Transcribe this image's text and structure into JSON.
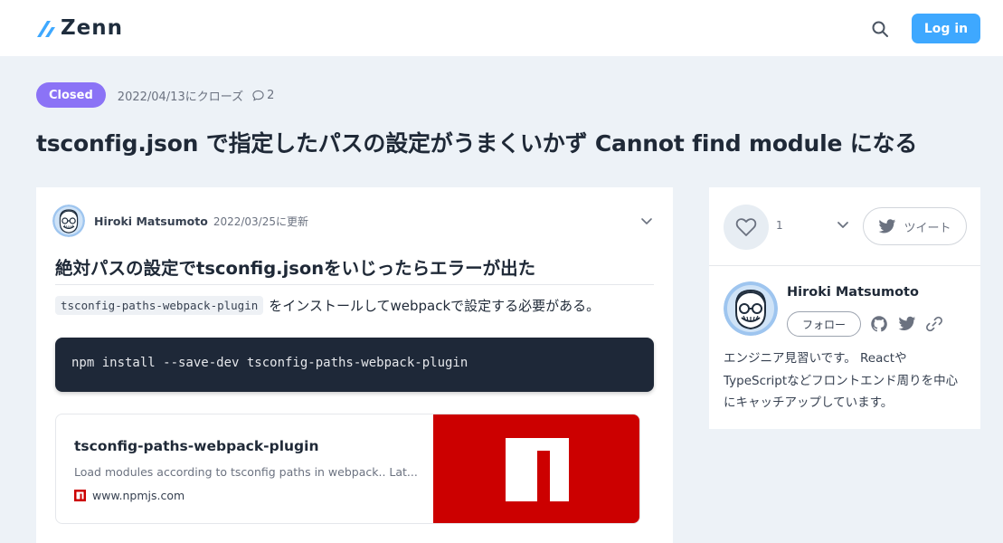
{
  "header": {
    "logo_text": "Zenn",
    "login_label": "Log in"
  },
  "discussion": {
    "status_label": "Closed",
    "closed_date": "2022/04/13にクローズ",
    "comment_count": "2",
    "title": "tsconfig.json で指定したパスの設定がうまくいかず Cannot find module になる"
  },
  "post": {
    "author_name": "Hiroki Matsumoto",
    "updated": "2022/03/25に更新",
    "heading": "絶対パスの設定でtsconfig.jsonをいじったらエラーが出た",
    "inline_code": "tsconfig-paths-webpack-plugin",
    "body_text": "をインストールしてwebpackで設定する必要がある。",
    "code": "npm install --save-dev tsconfig-paths-webpack-plugin",
    "link_card": {
      "title": "tsconfig-paths-webpack-plugin",
      "description": "Load modules according to tsconfig paths in webpack.. Lat...",
      "host": "www.npmjs.com"
    }
  },
  "sidebar": {
    "like_count": "1",
    "tweet_label": "ツイート",
    "author_name": "Hiroki Matsumoto",
    "follow_label": "フォロー",
    "bio": "エンジニア見習いです。 ReactやTypeScriptなどフロントエンド周りを中心にキャッチアップしています。"
  },
  "colors": {
    "accent": "#3ea8ff",
    "closed_badge": "#8b73f6",
    "npm_red": "#cc0000",
    "code_bg": "#1e2838",
    "page_bg": "#edf2f7"
  },
  "icons": [
    "zenn-logo-icon",
    "search-icon",
    "comment-icon",
    "chevron-down-icon",
    "npm-favicon-icon",
    "npm-logo-icon",
    "heart-icon",
    "twitter-icon",
    "github-icon",
    "link-icon"
  ]
}
